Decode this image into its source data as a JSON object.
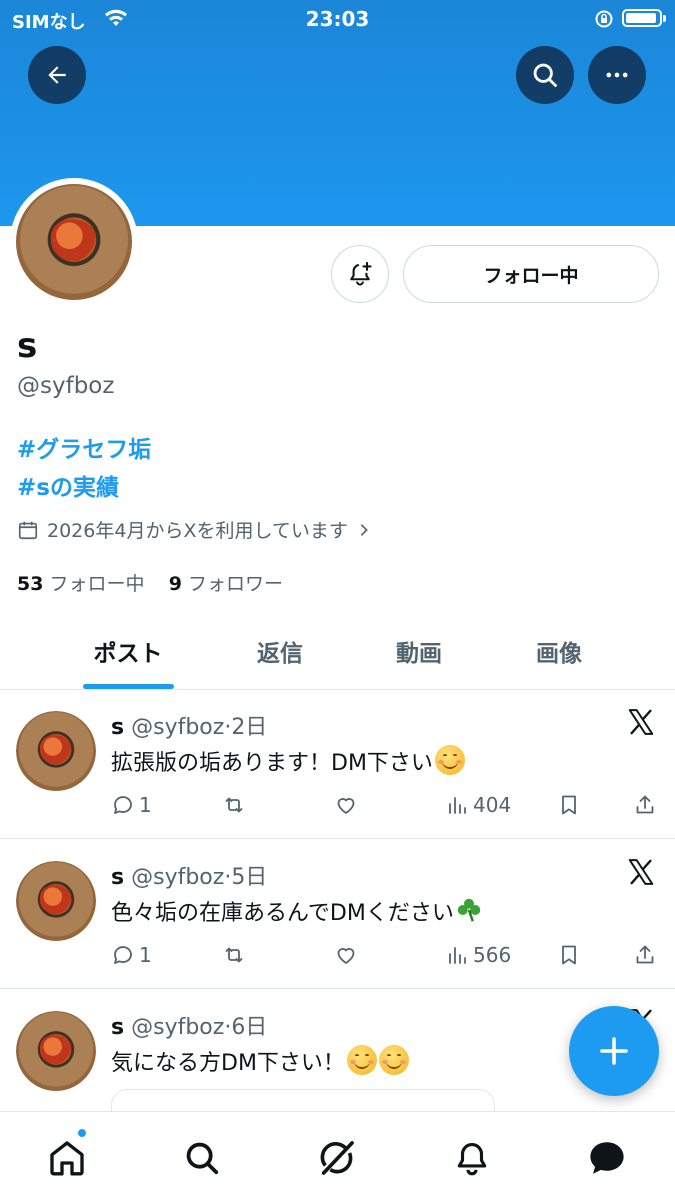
{
  "status_bar": {
    "carrier": "SIMなし",
    "time": "23:03"
  },
  "profile": {
    "name": "s",
    "handle": "@syfboz",
    "hashtags": [
      "#グラセフ垢",
      "#sの実績"
    ],
    "joined": "2026年4月からXを利用しています",
    "following_count": "53",
    "following_label": "フォロー中",
    "followers_count": "9",
    "followers_label": "フォロワー",
    "follow_button": "フォロー中"
  },
  "tabs": [
    "ポスト",
    "返信",
    "動画",
    "画像"
  ],
  "active_tab": "ポスト",
  "posts": [
    {
      "name": "s",
      "handle": "@syfboz",
      "age": "2日",
      "text": "拡張版の垢あります！DM下さい",
      "emojis": 1,
      "emoji_type": "smile",
      "replies": "1",
      "views": "404"
    },
    {
      "name": "s",
      "handle": "@syfboz",
      "age": "5日",
      "text": "色々垢の在庫あるんでDMください",
      "emojis": 1,
      "emoji_type": "clover",
      "replies": "1",
      "views": "566"
    },
    {
      "name": "s",
      "handle": "@syfboz",
      "age": "6日",
      "text": "気になる方DM下さい！",
      "emojis": 2,
      "emoji_type": "smile"
    }
  ],
  "colors": {
    "accent": "#1d9bf0",
    "banner": "#1d97ee",
    "muted": "#536471",
    "text": "#0f1419"
  },
  "icons": [
    "back-arrow-icon",
    "search-icon",
    "more-icon",
    "bell-plus-icon",
    "calendar-icon",
    "chevron-right-icon",
    "x-logo-icon",
    "reply-icon",
    "retweet-icon",
    "like-icon",
    "views-icon",
    "bookmark-icon",
    "share-icon",
    "compose-plus-icon",
    "home-icon",
    "search-nav-icon",
    "grok-icon",
    "notifications-icon",
    "messages-icon"
  ]
}
